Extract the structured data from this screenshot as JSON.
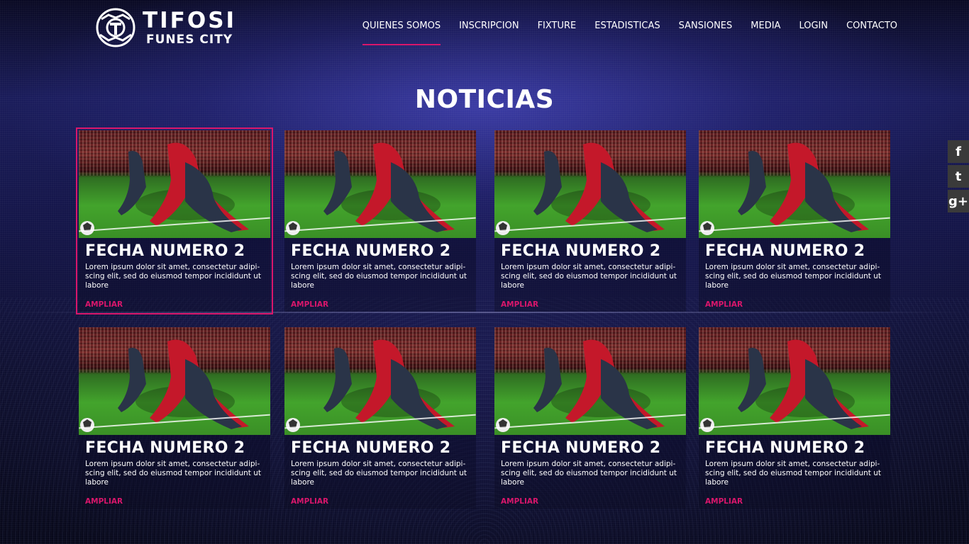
{
  "brand": {
    "title": "TIFOSI",
    "subtitle": "FUNES CITY"
  },
  "nav": {
    "items": [
      {
        "label": "QUIENES SOMOS",
        "active": true
      },
      {
        "label": "INSCRIPCION"
      },
      {
        "label": "FIXTURE"
      },
      {
        "label": "ESTADISTICAS"
      },
      {
        "label": "SANSIONES"
      },
      {
        "label": "MEDIA"
      },
      {
        "label": "LOGIN"
      },
      {
        "label": "CONTACTO"
      }
    ]
  },
  "page": {
    "title": "NOTICIAS"
  },
  "news": {
    "cards": [
      {
        "title": "FECHA NUMERO 2",
        "text": "Lorem ipsum dolor sit amet, consectetur adipi-scing elit, sed do eiusmod tempor incididunt ut labore",
        "link": "AMPLIAR",
        "active": true
      },
      {
        "title": "FECHA NUMERO 2",
        "text": "Lorem ipsum dolor sit amet, consectetur adipi-scing elit, sed do eiusmod tempor incididunt ut labore",
        "link": "AMPLIAR"
      },
      {
        "title": "FECHA NUMERO 2",
        "text": "Lorem ipsum dolor sit amet, consectetur adipi-scing elit, sed do eiusmod tempor incididunt ut labore",
        "link": "AMPLIAR"
      },
      {
        "title": "FECHA NUMERO 2",
        "text": "Lorem ipsum dolor sit amet, consectetur adipi-scing elit, sed do eiusmod tempor incididunt ut labore",
        "link": "AMPLIAR"
      },
      {
        "title": "FECHA NUMERO 2",
        "text": "Lorem ipsum dolor sit amet, consectetur adipi-scing elit, sed do eiusmod tempor incididunt ut labore",
        "link": "AMPLIAR"
      },
      {
        "title": "FECHA NUMERO 2",
        "text": "Lorem ipsum dolor sit amet, consectetur adipi-scing elit, sed do eiusmod tempor incididunt ut labore",
        "link": "AMPLIAR"
      },
      {
        "title": "FECHA NUMERO 2",
        "text": "Lorem ipsum dolor sit amet, consectetur adipi-scing elit, sed do eiusmod tempor incididunt ut labore",
        "link": "AMPLIAR"
      },
      {
        "title": "FECHA NUMERO 2",
        "text": "Lorem ipsum dolor sit amet, consectetur adipi-scing elit, sed do eiusmod tempor incididunt ut labore",
        "link": "AMPLIAR"
      }
    ]
  },
  "social": {
    "items": [
      {
        "icon": "facebook-icon",
        "glyph": "f"
      },
      {
        "icon": "twitter-icon",
        "glyph": "t"
      },
      {
        "icon": "google-plus-icon",
        "glyph": "g+"
      }
    ]
  },
  "colors": {
    "accent": "#d9166b",
    "background": "#141548"
  }
}
